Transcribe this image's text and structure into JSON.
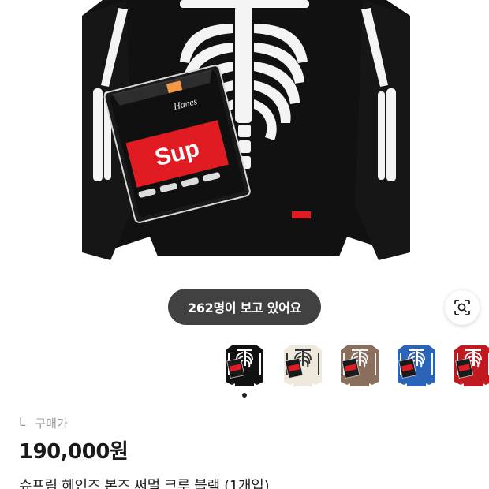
{
  "viewer_banner": {
    "text": "262명이 보고 있어요"
  },
  "product": {
    "size": "L",
    "price_type": "구매가",
    "price": "190,000원",
    "title": "슈프림 헤인즈 본즈 써멀 크루 블랙 (1개입)"
  },
  "hero_image": {
    "package_brand": "Hanes",
    "box_logo": "Sup",
    "colors": {
      "shirt": "#111111",
      "bones": "#f4f4f4",
      "box_logo_red": "#e01b22"
    }
  },
  "thumbnails": [
    {
      "color": "#111111",
      "bone": "#ffffff",
      "selected": true
    },
    {
      "color": "#efe9dd",
      "bone": "#333333",
      "selected": false
    },
    {
      "color": "#8a6f5c",
      "bone": "#f2f2f2",
      "selected": false
    },
    {
      "color": "#2a63b8",
      "bone": "#ffffff",
      "selected": false
    },
    {
      "color": "#c01920",
      "bone": "#ffffff",
      "selected": false
    }
  ],
  "icons": {
    "lens": "lens-search-icon"
  }
}
